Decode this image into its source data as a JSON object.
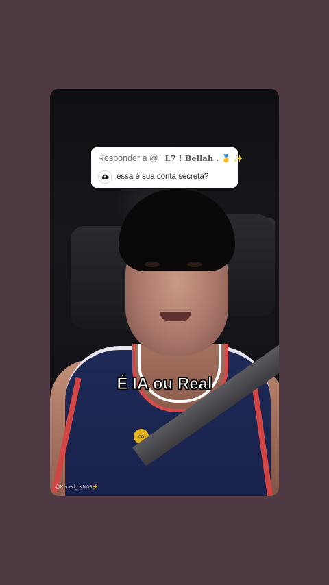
{
  "reply_sticker": {
    "prefix": "Responder a @",
    "handle": "˙ L7 ! Bellah . ",
    "emojis": "🥇 ✨",
    "avatar_icon": "cloud-upload-icon",
    "question": "essa é sua conta secreta?"
  },
  "caption": {
    "text": "É IA ou Real"
  },
  "watermark": {
    "text": "@Kened_ KN09⚡"
  },
  "jersey": {
    "badge_symbol": "∞"
  },
  "colors": {
    "page_background": "#4f3a44",
    "sticker_background": "#ffffff",
    "caption_text": "#ffffff"
  }
}
